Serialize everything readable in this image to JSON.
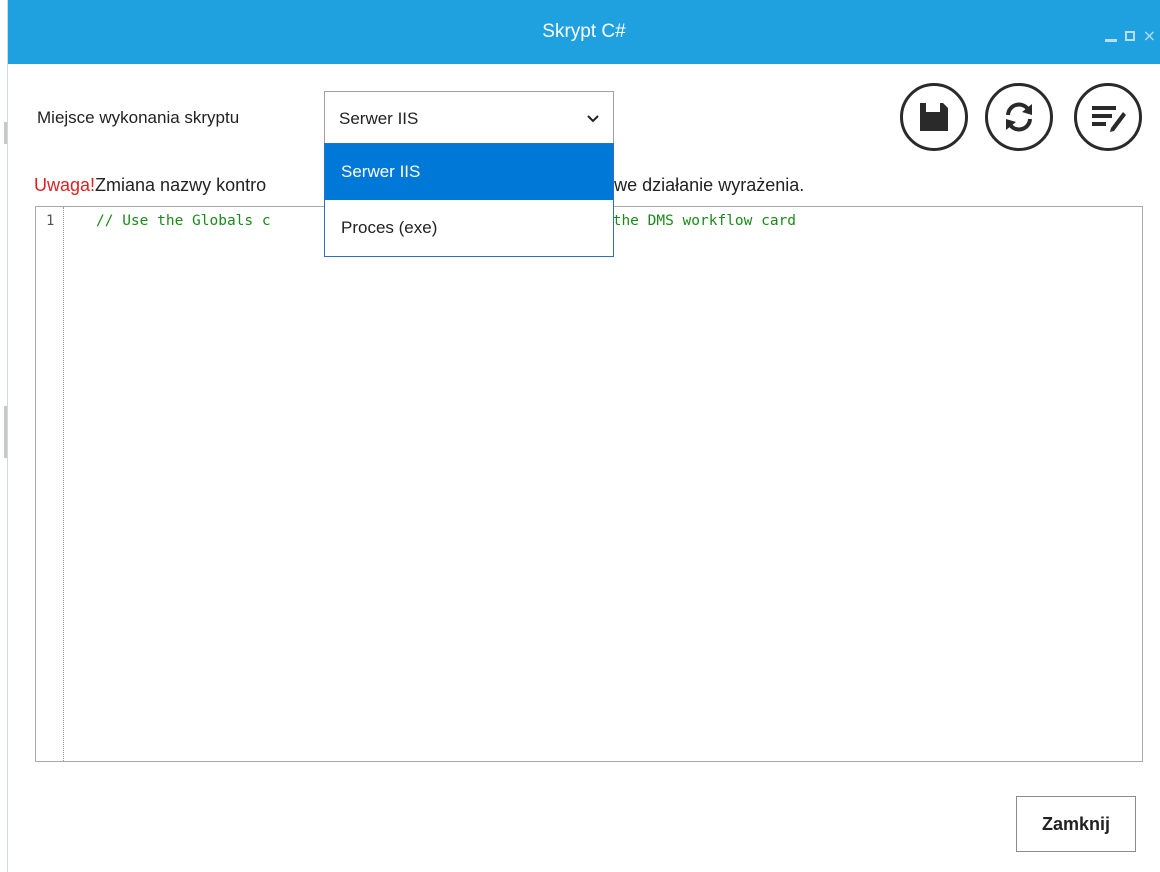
{
  "window": {
    "title": "Skrypt C#",
    "accent_color": "#1fa0df",
    "controls": {
      "minimize": "minimize-icon",
      "maximize": "maximize-icon",
      "close": "×"
    }
  },
  "execution": {
    "label": "Miejsce wykonania skryptu",
    "selected": "Serwer IIS",
    "options": [
      "Serwer IIS",
      "Proces (exe)"
    ],
    "dropdown_open": true
  },
  "toolbar": {
    "buttons": [
      {
        "name": "save-icon"
      },
      {
        "name": "refresh-icon"
      },
      {
        "name": "format-icon"
      }
    ]
  },
  "warning": {
    "prefix": "Uwaga!",
    "text": "Zmiana nazwy kontro",
    "text_end": "rawidłowe działanie wyrażenia.",
    "prefix_color": "#e02020"
  },
  "editor": {
    "line_number": "1",
    "code_start": "// Use the Globals c",
    "code_end": "s from the DMS workflow card"
  },
  "footer": {
    "close_label": "Zamknij"
  }
}
